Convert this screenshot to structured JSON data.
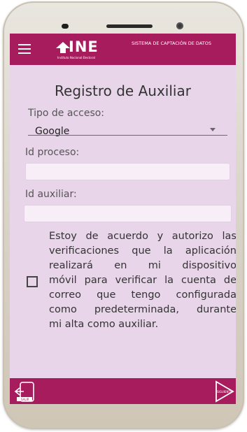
{
  "header": {
    "logo_text": "INE",
    "logo_subtitle": "Instituto Nacional Electoral",
    "system_title": "SISTEMA DE CAPTACIÓN DE DATOS"
  },
  "form": {
    "title": "Registro de Auxiliar",
    "access_type": {
      "label": "Tipo de acceso:",
      "value": "Google"
    },
    "process_id": {
      "label": "Id proceso:",
      "value": ""
    },
    "auxiliary_id": {
      "label": "Id auxiliar:",
      "value": ""
    },
    "consent": {
      "checked": false,
      "lines": [
        "Estoy de acuerdo y autorizo las",
        "verificaciones que la aplicación",
        "realizará en mi dispositivo",
        "móvil para verificar la cuenta de",
        "correo que tengo configurada",
        "como predeterminada, durante",
        "mi alta como auxiliar."
      ]
    }
  },
  "footer": {
    "back_label": "SALIR",
    "next_label": "SIGUIENTE"
  },
  "colors": {
    "brand": "#a61c5d",
    "screen_bg": "#e9d5ea",
    "input_bg": "#f7eef8"
  },
  "icons": {
    "menu": "hamburger-icon",
    "back": "exit-icon",
    "next": "play-arrow-icon"
  }
}
